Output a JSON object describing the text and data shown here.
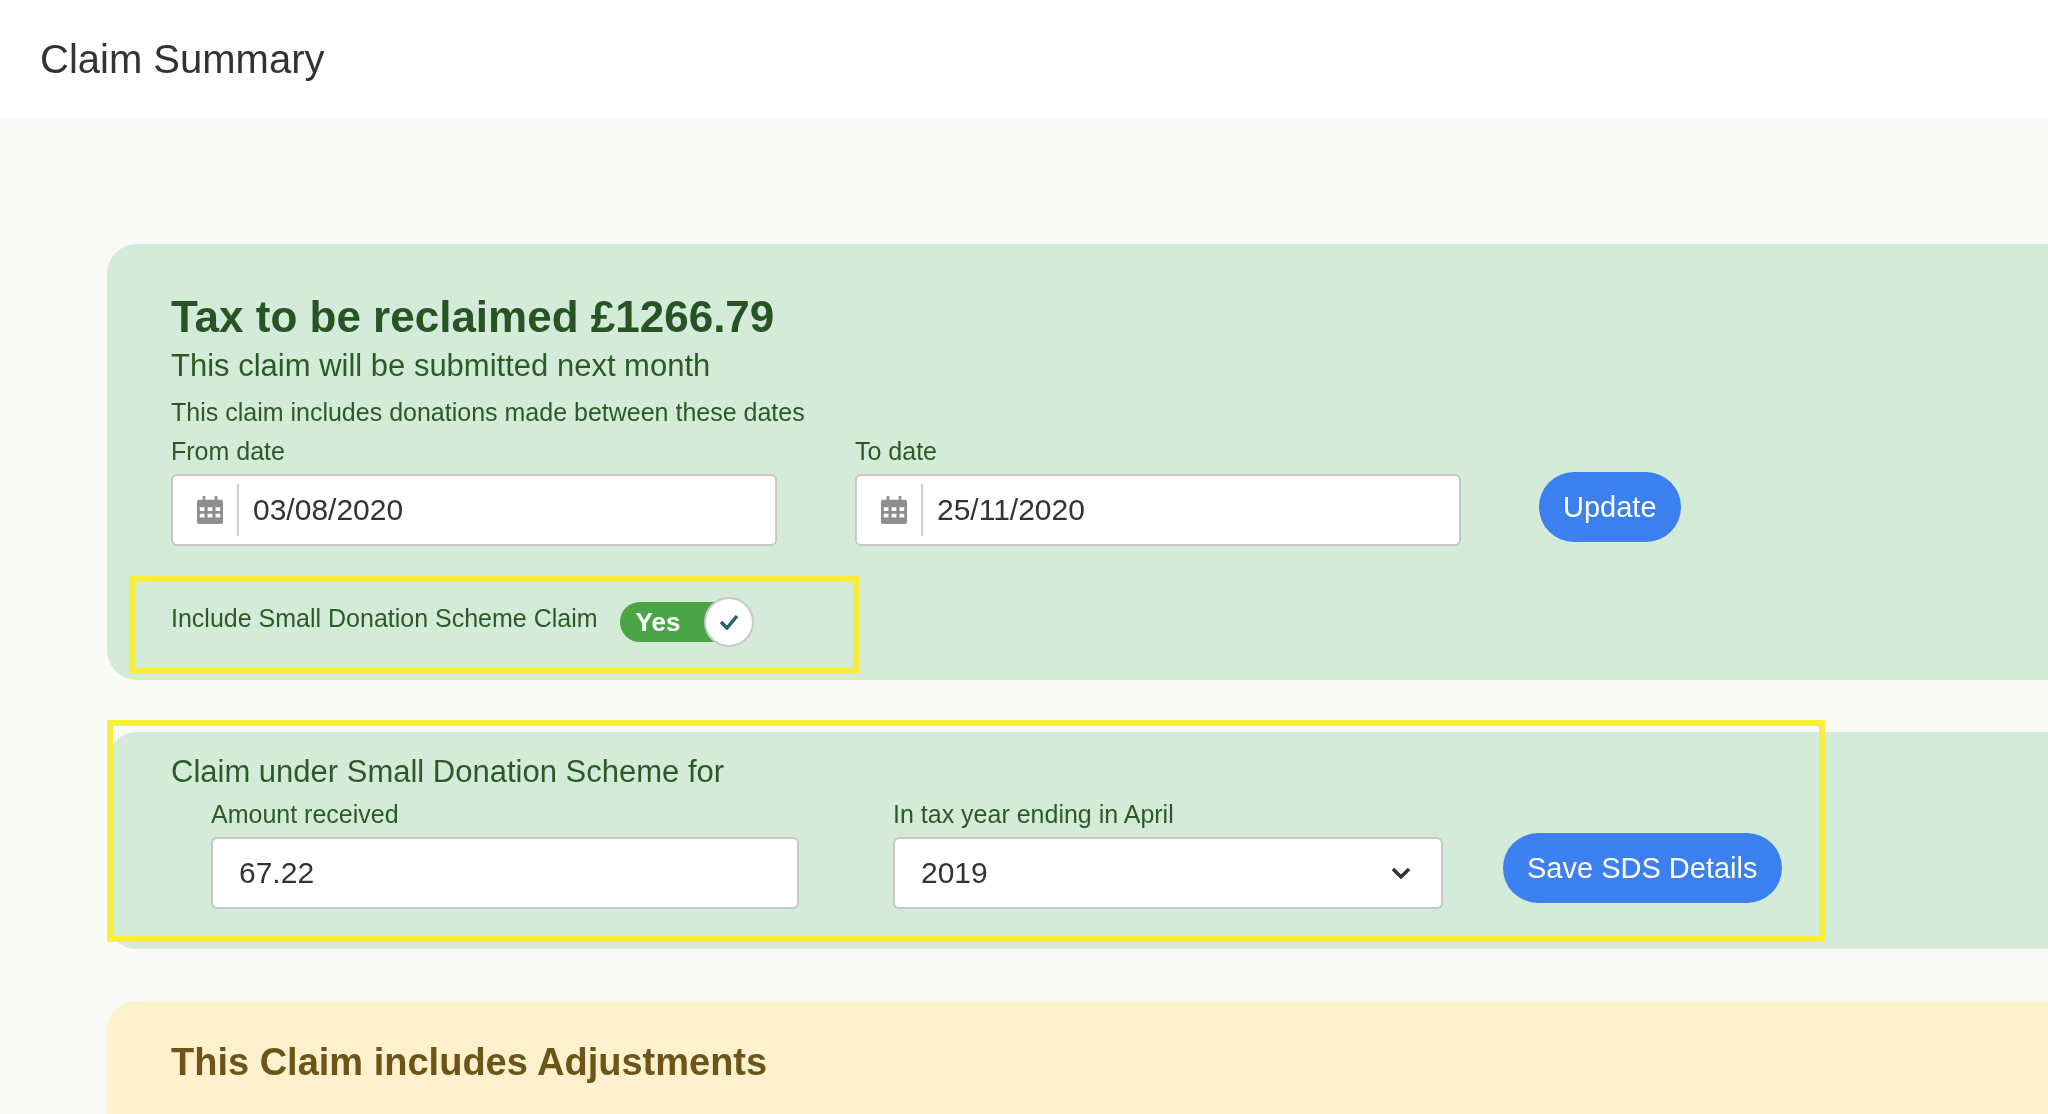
{
  "header": {
    "title": "Claim Summary"
  },
  "claim_panel": {
    "heading": "Tax to be reclaimed £1266.79",
    "subheading": "This claim will be submitted next month",
    "dates_note": "This claim includes donations made between these dates",
    "from_date": {
      "label": "From date",
      "value": "03/08/2020"
    },
    "to_date": {
      "label": "To date",
      "value": "25/11/2020"
    },
    "update_button": "Update",
    "sds_toggle": {
      "label": "Include Small Donation Scheme Claim",
      "on_text": "Yes",
      "checked": true,
      "highlighted": true
    }
  },
  "sds_panel": {
    "heading": "Claim under Small Donation Scheme for",
    "highlighted": true,
    "amount": {
      "label": "Amount received",
      "value": "67.22"
    },
    "tax_year": {
      "label": "In tax year ending in April",
      "value": "2019"
    },
    "save_button": "Save SDS Details"
  },
  "adjustments_panel": {
    "heading": "This Claim includes Adjustments"
  }
}
